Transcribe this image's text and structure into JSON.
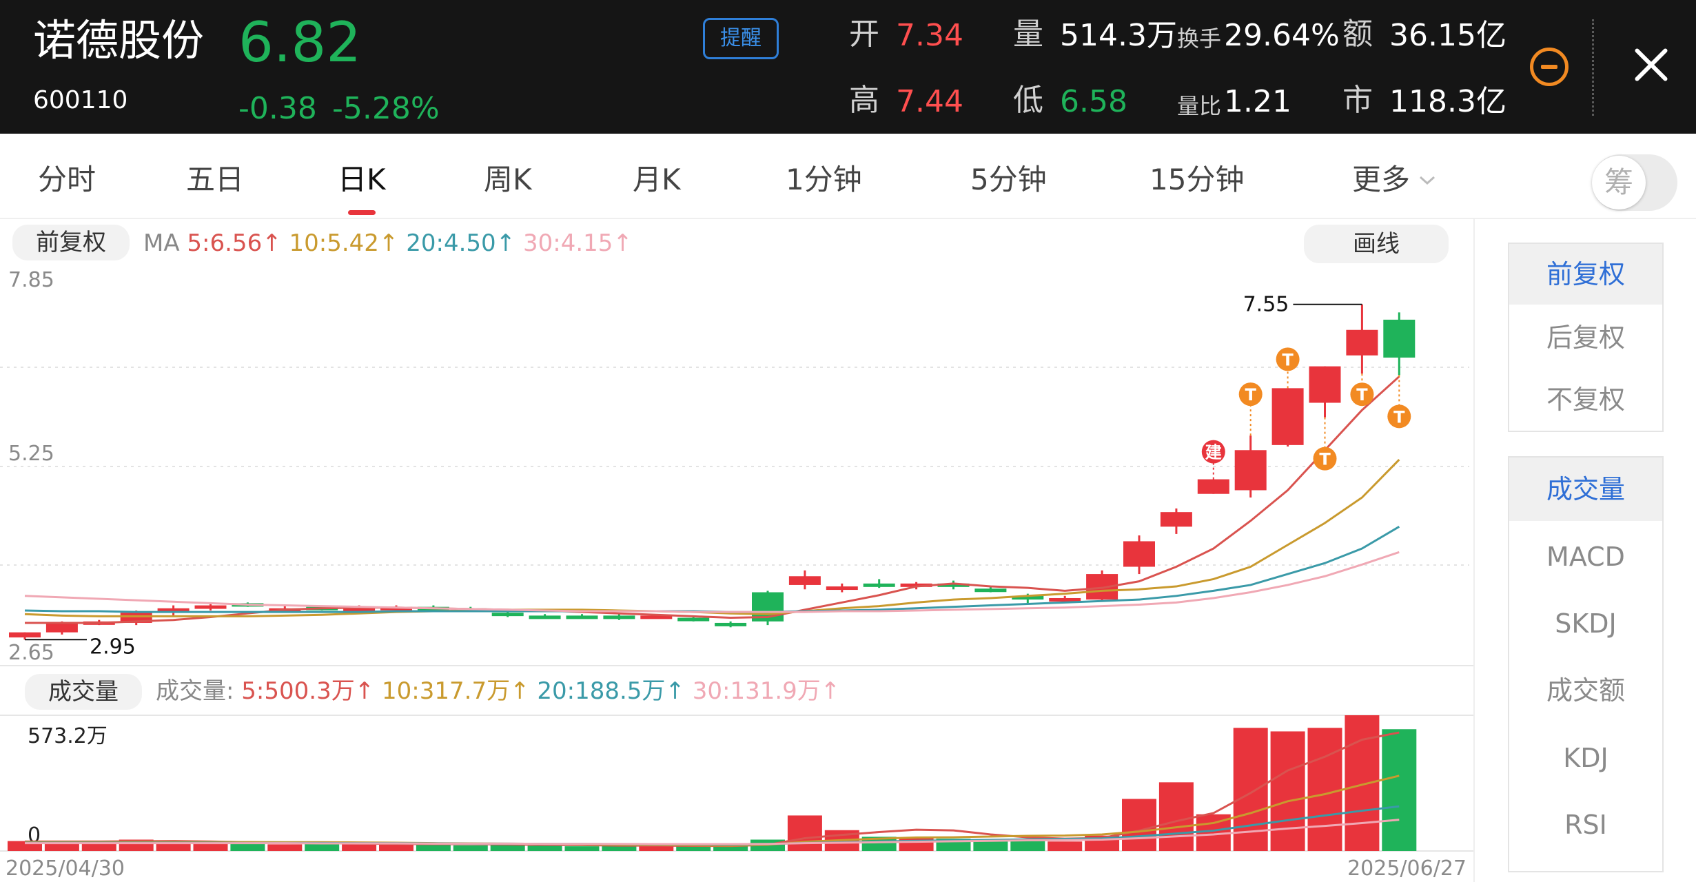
{
  "header": {
    "name": "诺德股份",
    "code": "600110",
    "price": "6.82",
    "change": "-0.38",
    "change_pct": "-5.28%",
    "alert_label": "提醒",
    "quotes": [
      {
        "label": "开",
        "value": "7.34",
        "color": "red"
      },
      {
        "label": "量",
        "value": "514.3万",
        "color": "white"
      },
      {
        "label": "换手",
        "value": "29.64%",
        "color": "white"
      },
      {
        "label": "额",
        "value": "36.15亿",
        "color": "white"
      },
      {
        "label": "高",
        "value": "7.44",
        "color": "red"
      },
      {
        "label": "低",
        "value": "6.58",
        "color": "green"
      },
      {
        "label": "量比",
        "value": "1.21",
        "color": "white"
      },
      {
        "label": "市",
        "value": "118.3亿",
        "color": "white"
      }
    ]
  },
  "tabs": [
    {
      "label": "分时"
    },
    {
      "label": "五日"
    },
    {
      "label": "日K",
      "active": true
    },
    {
      "label": "周K"
    },
    {
      "label": "月K"
    },
    {
      "label": "1分钟"
    },
    {
      "label": "5分钟"
    },
    {
      "label": "15分钟"
    },
    {
      "label": "更多"
    }
  ],
  "chips_toggle_label": "筹",
  "adjust_label": "前复权",
  "draw_label": "画线",
  "ma_legend": {
    "prefix": "MA",
    "items": [
      {
        "text": "5:6.56↑",
        "color": "#d9534f"
      },
      {
        "text": "10:5.42↑",
        "color": "#c99a2e"
      },
      {
        "text": "20:4.50↑",
        "color": "#3a9aa8"
      },
      {
        "text": "30:4.15↑",
        "color": "#f0a8b4"
      }
    ]
  },
  "volume_label": "成交量",
  "vol_legend": {
    "prefix": "成交量:",
    "items": [
      {
        "text": "5:500.3万↑",
        "color": "#d9534f"
      },
      {
        "text": "10:317.7万↑",
        "color": "#c99a2e"
      },
      {
        "text": "20:188.5万↑",
        "color": "#3a9aa8"
      },
      {
        "text": "30:131.9万↑",
        "color": "#f0a8b4"
      }
    ]
  },
  "right_panel": {
    "adjust_options": [
      {
        "label": "前复权",
        "active": true
      },
      {
        "label": "后复权"
      },
      {
        "label": "不复权"
      }
    ],
    "indicators": [
      {
        "label": "成交量",
        "active": true
      },
      {
        "label": "MACD"
      },
      {
        "label": "SKDJ"
      },
      {
        "label": "成交额"
      },
      {
        "label": "KDJ"
      },
      {
        "label": "RSI"
      }
    ]
  },
  "colors": {
    "up": "#e8343c",
    "down": "#1fb35a",
    "accent": "#2f6fd6",
    "alert": "#f28a22"
  },
  "chart_data": {
    "type": "candlestick",
    "price_axis_labels": [
      "7.85",
      "5.25",
      "2.65"
    ],
    "ylim": [
      2.65,
      7.85
    ],
    "high_marker": "7.55",
    "low_marker": "2.95",
    "date_start": "2025/04/30",
    "date_end": "2025/06/27",
    "volume_axis_labels": [
      "573.2万",
      "0"
    ],
    "volume_ylim": [
      0,
      573.2
    ],
    "candles": [
      {
        "o": 2.98,
        "h": 3.05,
        "l": 2.95,
        "c": 3.05,
        "v": 42
      },
      {
        "o": 3.05,
        "h": 3.2,
        "l": 3.02,
        "c": 3.18,
        "v": 38
      },
      {
        "o": 3.18,
        "h": 3.22,
        "l": 3.15,
        "c": 3.2,
        "v": 35
      },
      {
        "o": 3.18,
        "h": 3.35,
        "l": 3.15,
        "c": 3.32,
        "v": 48
      },
      {
        "o": 3.32,
        "h": 3.42,
        "l": 3.28,
        "c": 3.38,
        "v": 40
      },
      {
        "o": 3.38,
        "h": 3.45,
        "l": 3.35,
        "c": 3.42,
        "v": 32
      },
      {
        "o": 3.45,
        "h": 3.46,
        "l": 3.4,
        "c": 3.41,
        "v": 30
      },
      {
        "o": 3.38,
        "h": 3.42,
        "l": 3.36,
        "c": 3.38,
        "v": 28
      },
      {
        "o": 3.4,
        "h": 3.42,
        "l": 3.35,
        "c": 3.37,
        "v": 32
      },
      {
        "o": 3.35,
        "h": 3.42,
        "l": 3.33,
        "c": 3.38,
        "v": 30
      },
      {
        "o": 3.38,
        "h": 3.42,
        "l": 3.36,
        "c": 3.4,
        "v": 29
      },
      {
        "o": 3.4,
        "h": 3.42,
        "l": 3.36,
        "c": 3.38,
        "v": 26
      },
      {
        "o": 3.38,
        "h": 3.4,
        "l": 3.33,
        "c": 3.35,
        "v": 24
      },
      {
        "o": 3.32,
        "h": 3.35,
        "l": 3.26,
        "c": 3.3,
        "v": 26
      },
      {
        "o": 3.28,
        "h": 3.3,
        "l": 3.25,
        "c": 3.27,
        "v": 22
      },
      {
        "o": 3.28,
        "h": 3.3,
        "l": 3.25,
        "c": 3.27,
        "v": 20
      },
      {
        "o": 3.28,
        "h": 3.32,
        "l": 3.22,
        "c": 3.26,
        "v": 22
      },
      {
        "o": 3.25,
        "h": 3.3,
        "l": 3.24,
        "c": 3.28,
        "v": 21
      },
      {
        "o": 3.25,
        "h": 3.28,
        "l": 3.2,
        "c": 3.22,
        "v": 20
      },
      {
        "o": 3.18,
        "h": 3.2,
        "l": 3.12,
        "c": 3.14,
        "v": 22
      },
      {
        "o": 3.6,
        "h": 3.62,
        "l": 3.15,
        "c": 3.2,
        "v": 48
      },
      {
        "o": 3.7,
        "h": 3.9,
        "l": 3.64,
        "c": 3.82,
        "v": 150
      },
      {
        "o": 3.65,
        "h": 3.72,
        "l": 3.6,
        "c": 3.68,
        "v": 88
      },
      {
        "o": 3.72,
        "h": 3.78,
        "l": 3.66,
        "c": 3.7,
        "v": 60
      },
      {
        "o": 3.68,
        "h": 3.74,
        "l": 3.64,
        "c": 3.72,
        "v": 58
      },
      {
        "o": 3.72,
        "h": 3.76,
        "l": 3.64,
        "c": 3.7,
        "v": 52
      },
      {
        "o": 3.65,
        "h": 3.68,
        "l": 3.6,
        "c": 3.62,
        "v": 48
      },
      {
        "o": 3.55,
        "h": 3.58,
        "l": 3.45,
        "c": 3.5,
        "v": 45
      },
      {
        "o": 3.5,
        "h": 3.55,
        "l": 3.45,
        "c": 3.52,
        "v": 40
      },
      {
        "o": 3.5,
        "h": 3.9,
        "l": 3.48,
        "c": 3.85,
        "v": 65
      },
      {
        "o": 3.95,
        "h": 4.38,
        "l": 3.85,
        "c": 4.3,
        "v": 220
      },
      {
        "o": 4.5,
        "h": 4.75,
        "l": 4.4,
        "c": 4.7,
        "v": 290
      },
      {
        "o": 4.95,
        "h": 5.15,
        "l": 4.95,
        "c": 5.15,
        "v": 155
      },
      {
        "o": 5.0,
        "h": 5.75,
        "l": 4.9,
        "c": 5.55,
        "v": 520
      },
      {
        "o": 5.62,
        "h": 6.4,
        "l": 5.6,
        "c": 6.4,
        "v": 505
      },
      {
        "o": 6.2,
        "h": 6.7,
        "l": 6.0,
        "c": 6.7,
        "v": 520
      },
      {
        "o": 6.85,
        "h": 7.55,
        "l": 6.6,
        "c": 7.2,
        "v": 573.2
      },
      {
        "o": 7.34,
        "h": 7.44,
        "l": 6.58,
        "c": 6.82,
        "v": 514.3
      }
    ],
    "ma_series": [
      {
        "name": "MA5",
        "color": "#d9534f",
        "values": [
          3.18,
          3.18,
          3.18,
          3.2,
          3.22,
          3.26,
          3.31,
          3.36,
          3.38,
          3.39,
          3.39,
          3.38,
          3.37,
          3.36,
          3.35,
          3.33,
          3.31,
          3.29,
          3.27,
          3.25,
          3.26,
          3.36,
          3.46,
          3.56,
          3.68,
          3.72,
          3.68,
          3.66,
          3.62,
          3.66,
          3.75,
          3.95,
          4.2,
          4.58,
          5.0,
          5.55,
          6.1,
          6.56
        ]
      },
      {
        "name": "MA10",
        "color": "#c99a2e",
        "values": [
          3.3,
          3.28,
          3.27,
          3.27,
          3.27,
          3.27,
          3.27,
          3.28,
          3.29,
          3.31,
          3.33,
          3.34,
          3.35,
          3.36,
          3.36,
          3.36,
          3.35,
          3.34,
          3.33,
          3.31,
          3.3,
          3.34,
          3.38,
          3.41,
          3.46,
          3.5,
          3.52,
          3.55,
          3.58,
          3.62,
          3.64,
          3.68,
          3.78,
          3.95,
          4.25,
          4.55,
          4.9,
          5.42
        ]
      },
      {
        "name": "MA20",
        "color": "#3a9aa8",
        "values": [
          3.35,
          3.34,
          3.34,
          3.33,
          3.33,
          3.33,
          3.33,
          3.33,
          3.33,
          3.33,
          3.34,
          3.34,
          3.34,
          3.34,
          3.34,
          3.34,
          3.34,
          3.34,
          3.34,
          3.33,
          3.33,
          3.34,
          3.35,
          3.36,
          3.38,
          3.4,
          3.42,
          3.44,
          3.46,
          3.48,
          3.5,
          3.55,
          3.62,
          3.7,
          3.85,
          4.0,
          4.2,
          4.5
        ]
      },
      {
        "name": "MA30",
        "color": "#f0a8b4",
        "values": [
          3.55,
          3.53,
          3.51,
          3.49,
          3.47,
          3.45,
          3.43,
          3.42,
          3.41,
          3.4,
          3.39,
          3.38,
          3.37,
          3.36,
          3.35,
          3.34,
          3.34,
          3.34,
          3.33,
          3.33,
          3.33,
          3.33,
          3.34,
          3.34,
          3.35,
          3.36,
          3.37,
          3.38,
          3.39,
          3.41,
          3.43,
          3.46,
          3.52,
          3.6,
          3.7,
          3.82,
          3.98,
          4.15
        ]
      }
    ],
    "vol_ma_series": [
      {
        "name": "5",
        "color": "#d9534f",
        "values": [
          40,
          40,
          40,
          41,
          42,
          40,
          37,
          35,
          33,
          31,
          30,
          29,
          29,
          28,
          26,
          25,
          23,
          23,
          22,
          21,
          26,
          54,
          68,
          80,
          90,
          87,
          70,
          58,
          52,
          55,
          86,
          126,
          160,
          245,
          340,
          398,
          470,
          500.3
        ]
      },
      {
        "name": "10",
        "color": "#c99a2e",
        "values": [
          38,
          38,
          38,
          38,
          38,
          38,
          38,
          37,
          37,
          36,
          35,
          33,
          32,
          31,
          30,
          28,
          26,
          25,
          24,
          23,
          26,
          39,
          46,
          52,
          57,
          58,
          61,
          64,
          65,
          70,
          82,
          100,
          118,
          160,
          210,
          240,
          280,
          317.7
        ]
      },
      {
        "name": "20",
        "color": "#3a9aa8",
        "values": [
          35,
          35,
          35,
          35,
          35,
          35,
          34,
          34,
          34,
          33,
          33,
          32,
          31,
          31,
          30,
          30,
          29,
          28,
          28,
          27,
          29,
          34,
          37,
          40,
          43,
          45,
          47,
          49,
          51,
          53,
          62,
          74,
          86,
          108,
          130,
          150,
          170,
          188.5
        ]
      },
      {
        "name": "30",
        "color": "#f0a8b4",
        "values": [
          33,
          33,
          33,
          33,
          33,
          33,
          33,
          33,
          32,
          32,
          32,
          31,
          31,
          31,
          30,
          30,
          30,
          29,
          29,
          29,
          30,
          33,
          35,
          37,
          39,
          41,
          43,
          45,
          46,
          48,
          54,
          62,
          70,
          82,
          95,
          106,
          118,
          131.9
        ]
      }
    ],
    "signals": [
      {
        "index": 32,
        "label": "建",
        "color": "#e8343c",
        "at": "high",
        "offset": 40
      },
      {
        "index": 33,
        "label": "T",
        "color": "#f28a22",
        "at": "high",
        "offset": 60
      },
      {
        "index": 34,
        "label": "T",
        "color": "#f28a22",
        "at": "high",
        "offset": 42
      },
      {
        "index": 35,
        "label": "T",
        "color": "#f28a22",
        "at": "low",
        "offset": 60
      },
      {
        "index": 36,
        "label": "T",
        "color": "#f28a22",
        "at": "low",
        "offset": 30
      },
      {
        "index": 37,
        "label": "T",
        "color": "#f28a22",
        "at": "low",
        "offset": 60
      }
    ]
  }
}
